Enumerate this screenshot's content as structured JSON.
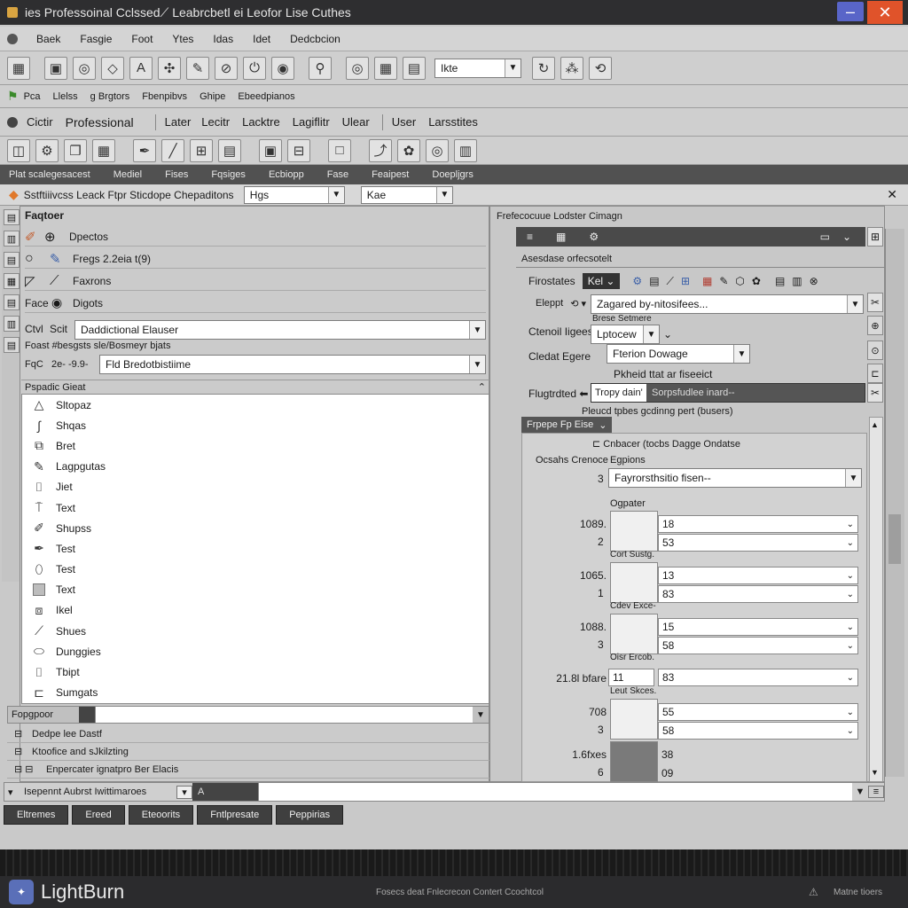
{
  "window": {
    "title": "ies Professoinal Cclssed⟋ Leabrcbetl ei Leofor Lise Cuthes"
  },
  "menu": [
    "Baek",
    "Fasgie",
    "Foot",
    "Ytes",
    "Idas",
    "Idet",
    "Dedcbcion"
  ],
  "toolbar1": {
    "combo_value": "Ikte",
    "icons": [
      "new-file-icon",
      "open-file-icon",
      "globe-icon",
      "diamond-icon",
      "text-tool-icon",
      "settings-icon",
      "edit-icon",
      "compass-icon",
      "power-icon",
      "record-icon",
      "wand-icon",
      "target-icon",
      "grid-icon",
      "layout-icon",
      "refresh-icon",
      "scatter-icon",
      "cycle-icon"
    ]
  },
  "toolbar2": {
    "items": [
      "Pca",
      "Llelss",
      "ɡ Brgtors",
      "Fbenpibvs",
      "Ghipe",
      "Ebeedpianos"
    ]
  },
  "toolbar3": {
    "items": [
      "Cictir",
      "Professional",
      "Later",
      "Lecitr",
      "Lacktre",
      "Lagiflitr",
      "Ulear",
      "User",
      "Larsstites"
    ]
  },
  "toolbar4": {
    "icons": [
      "layers-icon",
      "node-icon",
      "copy-icon",
      "grid-select-icon",
      "pen-icon",
      "knife-icon",
      "measure-icon",
      "table-icon",
      "image-icon",
      "align-icon",
      "frame-icon",
      "rotate-icon",
      "shapes-icon",
      "target-icon",
      "stack-icon"
    ]
  },
  "darkstrip": [
    "Plat scalegesacest",
    "Mediel",
    "Fises",
    "Fqsiges",
    "Ecbiopp",
    "Fase",
    "Feaipest",
    "Doepljgrs"
  ],
  "tabbar": {
    "label": "Sstftiiivcss Leack Ftpr Sticdope Chepaditons",
    "combo1": "Hgs",
    "combo2": "Kae"
  },
  "leftpanel": {
    "title": "Faqtoer",
    "rows": [
      {
        "label": "Dpectos"
      },
      {
        "label": "Fregs 2.2eia t(9)"
      },
      {
        "label": "Faxrons"
      },
      {
        "label": "Face",
        "label2": "Digots"
      }
    ],
    "field1": {
      "label1": "Ctvl",
      "label2": "Scit",
      "value": "Daddictional Elauser"
    },
    "field2": {
      "caption": "Foast  #besgsts sle/Bosmeyr bjats",
      "label1": "FqC",
      "label2": "2e- -9.9-",
      "value": "Fld Bredotbistiime"
    },
    "list_header": "Pspadic Gieat",
    "list": [
      "Sltopaz",
      "Shqas",
      "Bret",
      "Lagpgutas",
      "Jiet",
      "Text",
      "Shupss",
      "Test",
      "Test",
      "Text",
      "Ikel",
      "Shues",
      "Dunggies",
      "Tbipt",
      "Sumgats"
    ],
    "footer_label": "Fopgpoor",
    "tree": [
      "Dedpe lee Dastf",
      "Ktoofice and sJkilzting",
      "Enpercater ignatpro Ber Elacis"
    ],
    "cmd_label": "Isepennt Aubrst Iwittimaroes",
    "cmd_value": "A"
  },
  "rightpanel": {
    "title": "Frefecocuue Lodster Cimagn",
    "subheader": "Asesdase orfecsotelt",
    "tab1": "Firostates",
    "tab1_select": "Kel",
    "field_elepr": {
      "label": "Eleppt",
      "value": "Zagared by-nitosifees..."
    },
    "base_label": "Brese Setmere",
    "field_ctencil": {
      "label": "Ctenoil Iigees",
      "value": "Lptocew"
    },
    "field_cledat": {
      "label": "Cledat Egere",
      "value": "Fterion Dowage"
    },
    "pheid_label": "Pkheid ttat ar fiseeict",
    "field_flugtr": {
      "label": "Flugtrdted ⬅",
      "value": "Tropy dain'",
      "hint": "Sorpsfudlee inard--"
    },
    "pleicd_label": "Pleucd tpbes gcdinng pert (busers)",
    "section_tab": "Frpepe Fp Eise",
    "section_title": "Cnbacer (tocbs Dagge Ondatse",
    "ocsahs_label": "Ocsahs Crenoce",
    "egpions_label": "Egpions",
    "sel3": {
      "num": "3",
      "value": "Fayrorsthsitio fisen--"
    },
    "ogpater_label": "Ogpater",
    "swatches": [
      {
        "caption": "",
        "left1": "1089.",
        "left2": "2",
        "v1": "18",
        "v2": "53",
        "shade": "light"
      },
      {
        "caption": "Cort Sustg.",
        "left1": "1065.",
        "left2": "1",
        "v1": "13",
        "v2": "83",
        "shade": "light"
      },
      {
        "caption": "Cdev Exce-",
        "left1": "1088.",
        "left2": "3",
        "v1": "15",
        "v2": "58",
        "shade": "light"
      },
      {
        "caption": "Oisr Ercob.",
        "left1": "21.8l bfare",
        "left2": "",
        "v1": "11",
        "v2": "83",
        "shade": "light"
      },
      {
        "caption": "Leut Skces.",
        "left1": "708",
        "left2": "3",
        "v1": "55",
        "v2": "58",
        "shade": "light"
      },
      {
        "caption": "",
        "left1": "1.6fxes",
        "left2": "6",
        "v1": "38",
        "v2": "09",
        "shade": "dark"
      }
    ]
  },
  "bottom_tabs": [
    "Eltremes",
    "Ereed",
    "Eteoorits",
    "Fntlpresate",
    "Peppirias"
  ],
  "status": {
    "brand": "LightBurn",
    "center": "Fosecs deat Fnlecrecon Contert Ccochtcol",
    "right": "Matne tioers"
  },
  "colors": {
    "titlebar": "#2e2e30",
    "close": "#e0532a",
    "minimize": "#5965c8",
    "brand_icon": "#5a6fb8"
  }
}
